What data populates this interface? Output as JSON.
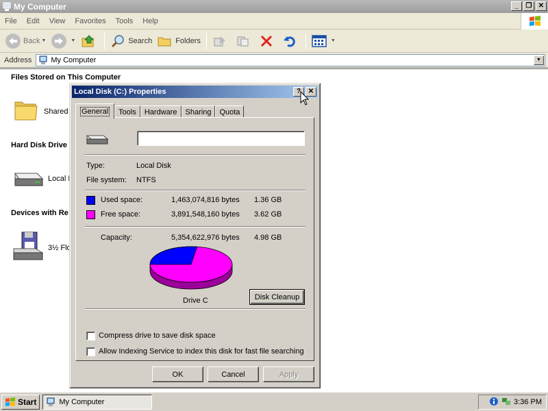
{
  "window": {
    "title": "My Computer",
    "menu": [
      "File",
      "Edit",
      "View",
      "Favorites",
      "Tools",
      "Help"
    ],
    "toolbar": {
      "back": "Back",
      "search": "Search",
      "folders": "Folders"
    },
    "address": {
      "label": "Address",
      "value": "My Computer"
    }
  },
  "content": {
    "groups": [
      {
        "title": "Files Stored on This Computer",
        "item": "Shared"
      },
      {
        "title": "Hard Disk Drive",
        "item": "Local D"
      },
      {
        "title": "Devices with Re",
        "item": "3½ Flo"
      }
    ]
  },
  "dialog": {
    "title": "Local Disk (C:) Properties",
    "help_btn": "?",
    "close_btn": "✕",
    "tabs": [
      "General",
      "Tools",
      "Hardware",
      "Sharing",
      "Quota"
    ],
    "name_value": "",
    "type_label": "Type:",
    "type_value": "Local Disk",
    "fs_label": "File system:",
    "fs_value": "NTFS",
    "used_label": "Used space:",
    "used_bytes": "1,463,074,816 bytes",
    "used_gb": "1.36 GB",
    "free_label": "Free space:",
    "free_bytes": "3,891,548,160 bytes",
    "free_gb": "3.62 GB",
    "cap_label": "Capacity:",
    "cap_bytes": "5,354,622,976 bytes",
    "cap_gb": "4.98 GB",
    "used_fraction": 0.2732,
    "drive_label": "Drive C",
    "cleanup_btn": "Disk Cleanup",
    "compress_label": "Compress drive to save disk space",
    "index_label": "Allow Indexing Service to index this disk for fast file searching",
    "ok": "OK",
    "cancel": "Cancel",
    "apply": "Apply"
  },
  "colors": {
    "used": "#0000ff",
    "free": "#ff00ff"
  },
  "taskbar": {
    "start": "Start",
    "task": "My Computer",
    "clock": "3:36 PM"
  }
}
